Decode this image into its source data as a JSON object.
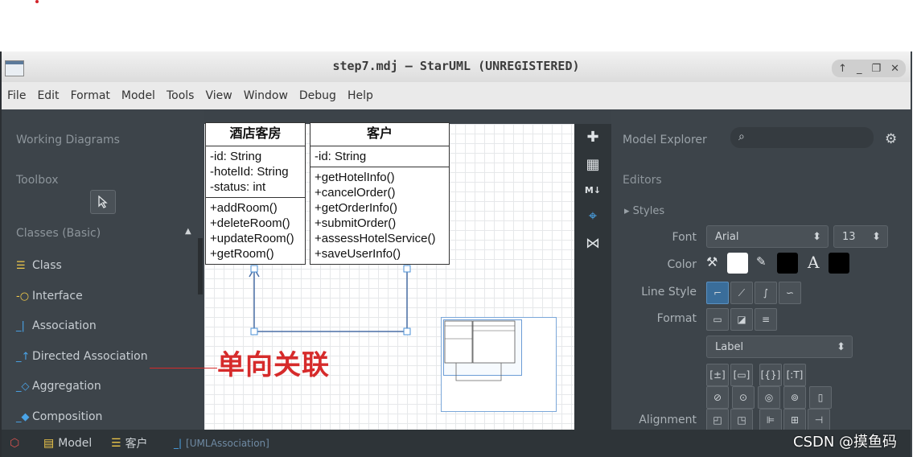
{
  "window": {
    "title": "step7.mdj — StarUML (UNREGISTERED)"
  },
  "controls": {
    "up": "↑",
    "min": "_",
    "restore": "❐",
    "close": "✕"
  },
  "menu": [
    "File",
    "Edit",
    "Format",
    "Model",
    "Tools",
    "View",
    "Window",
    "Debug",
    "Help"
  ],
  "left": {
    "working_diagrams": "Working Diagrams",
    "toolbox": "Toolbox",
    "classes_basic": "Classes (Basic)",
    "collapse_glyph": "▲",
    "items": [
      "Class",
      "Interface",
      "Association",
      "Directed Association",
      "Aggregation",
      "Composition"
    ]
  },
  "diagram": {
    "class1": {
      "name": "酒店客房",
      "attrs": [
        "-id: String",
        "-hotelId: String",
        "-status: int"
      ],
      "ops": [
        "+addRoom()",
        "+deleteRoom()",
        "+updateRoom()",
        "+getRoom()"
      ]
    },
    "class2": {
      "name": "客户",
      "attrs": [
        "-id: String"
      ],
      "ops": [
        "+getHotelInfo()",
        "+cancelOrder()",
        "+getOrderInfo()",
        "+submitOrder()",
        "+assessHotelService()",
        "+saveUserInfo()"
      ]
    }
  },
  "strip": {
    "md_badge": "M↓"
  },
  "right": {
    "model_explorer": "Model Explorer",
    "editors": "Editors",
    "styles": "Styles",
    "font_label": "Font",
    "font_value": "Arial",
    "font_size": "13",
    "color_label": "Color",
    "text_glyph": "A",
    "line_style_label": "Line Style",
    "format_label": "Format",
    "format_select": "Label",
    "alignment_label": "Alignment",
    "colors": {
      "fill": "#ffffff",
      "line": "#000000",
      "font": "#000000"
    }
  },
  "status": {
    "model": "Model",
    "selected": "客户",
    "element": "[UMLAssociation]"
  },
  "annotation": {
    "text": "单向关联"
  },
  "watermark": "CSDN @摸鱼码"
}
